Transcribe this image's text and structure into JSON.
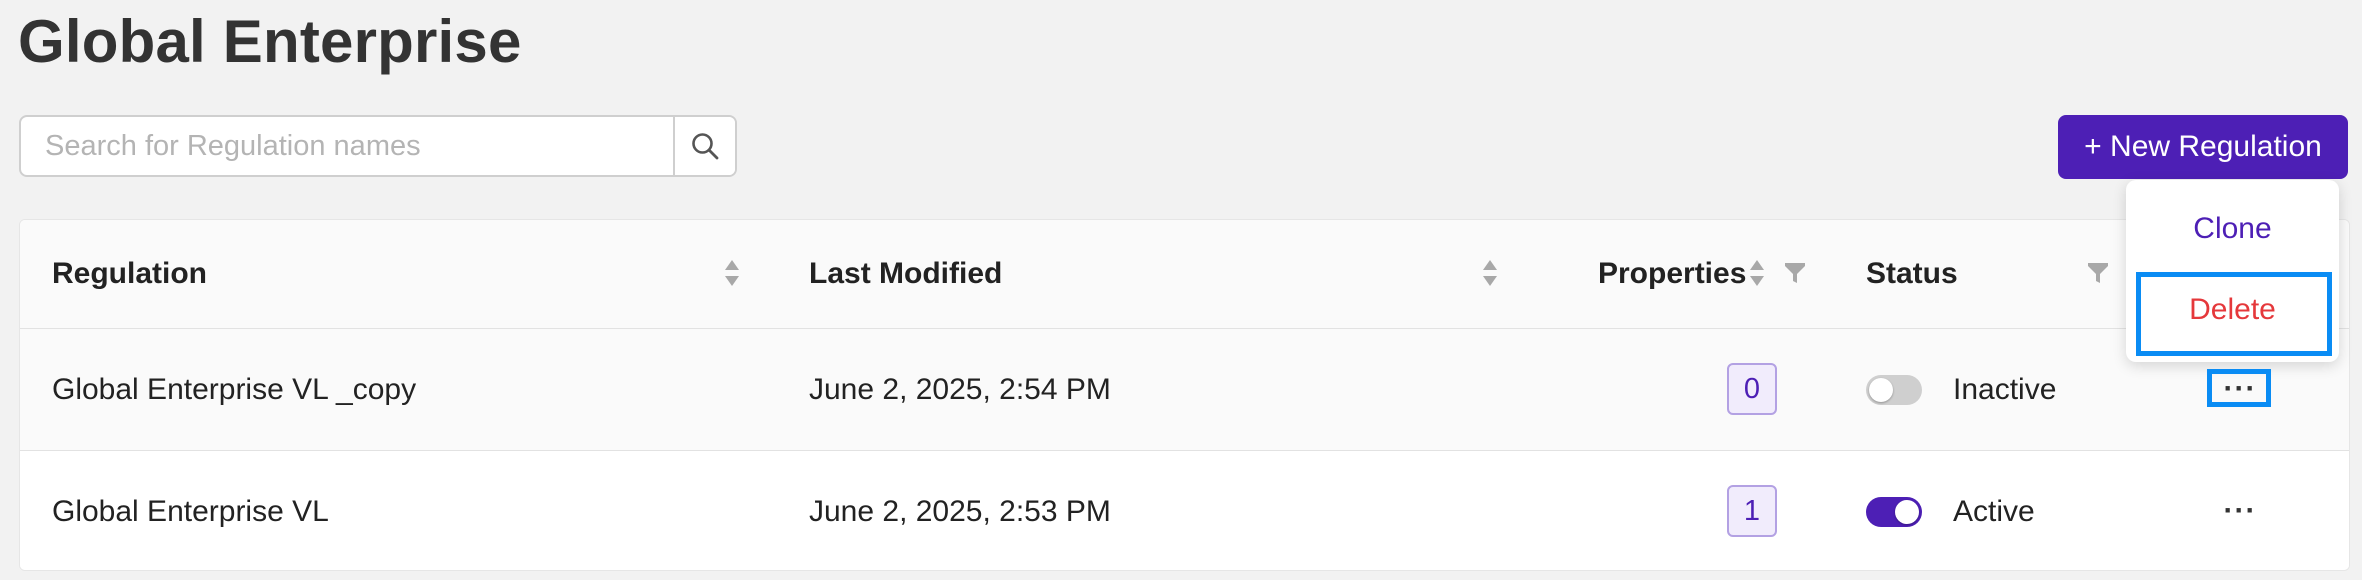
{
  "page": {
    "title": "Global Enterprise"
  },
  "search": {
    "placeholder": "Search for Regulation names",
    "value": "",
    "icon": "search-icon"
  },
  "toolbar": {
    "new_label": "+ New Regulation"
  },
  "table": {
    "columns": {
      "regulation": "Regulation",
      "last_modified": "Last Modified",
      "properties": "Properties",
      "status": "Status"
    },
    "rows": [
      {
        "name": "Global Enterprise VL _copy",
        "modified": "June 2, 2025, 2:54 PM",
        "properties": "0",
        "status": "Inactive",
        "active": false,
        "more": "···"
      },
      {
        "name": "Global Enterprise VL",
        "modified": "June 2, 2025, 2:53 PM",
        "properties": "1",
        "status": "Active",
        "active": true,
        "more": "···"
      }
    ]
  },
  "menu": {
    "clone_label": "Clone",
    "delete_label": "Delete"
  },
  "colors": {
    "accent": "#4d1fb5",
    "danger": "#e5383b",
    "highlight": "#0a8cf4"
  }
}
